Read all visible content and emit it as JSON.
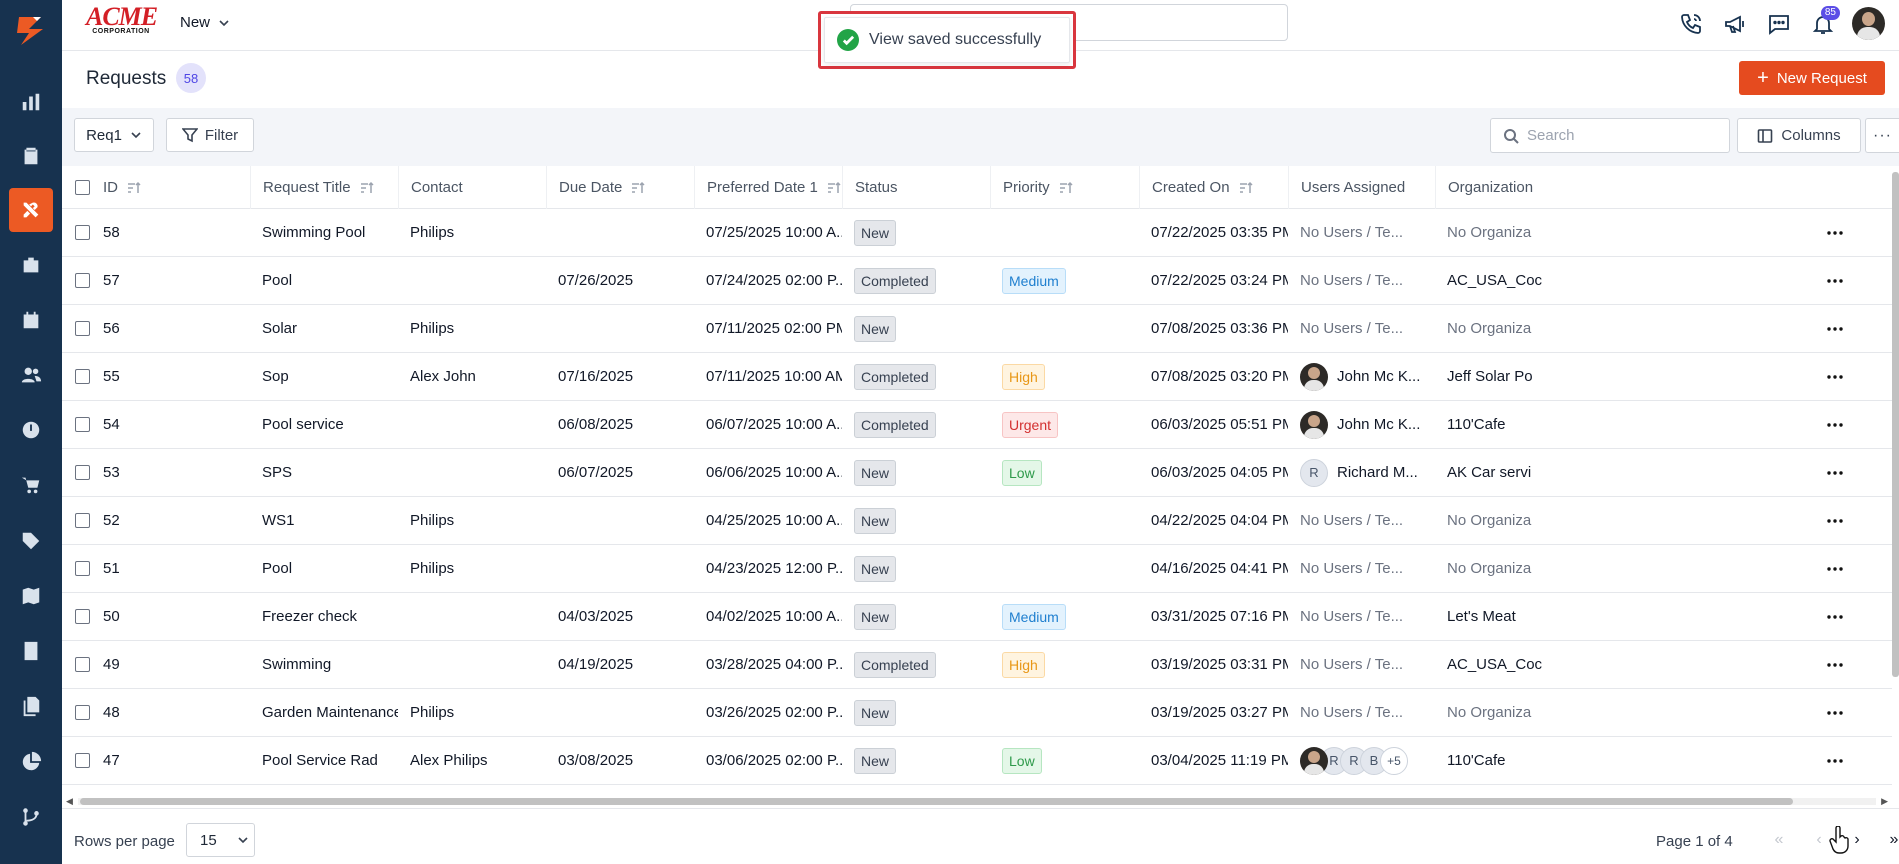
{
  "app": {
    "logo_text": "ACME",
    "logo_sub": "CORPORATION",
    "new_menu_label": "New",
    "notification_count": "85"
  },
  "toast": {
    "message": "View saved successfully"
  },
  "page": {
    "title": "Requests",
    "count": "58",
    "new_button": "New Request"
  },
  "toolbar": {
    "view_name": "Req1",
    "filter_label": "Filter",
    "search_placeholder": "Search",
    "columns_label": "Columns",
    "more_label": "···"
  },
  "table": {
    "columns": [
      "ID",
      "Request Title",
      "Contact",
      "Due Date",
      "Preferred Date 1",
      "Status",
      "Priority",
      "Created On",
      "Users Assigned",
      "Organization"
    ],
    "rows": [
      {
        "id": "58",
        "title": "Swimming Pool",
        "contact": "Philips",
        "due": "",
        "preferred": "07/25/2025 10:00 A...",
        "status": "New",
        "priority": "",
        "created": "07/22/2025 03:35 PM",
        "users": {
          "type": "none",
          "text": "No Users / Te..."
        },
        "org": "No Organiza",
        "org_muted": true
      },
      {
        "id": "57",
        "title": "Pool",
        "contact": "",
        "due": "07/26/2025",
        "preferred": "07/24/2025 02:00 P...",
        "status": "Completed",
        "priority": "Medium",
        "created": "07/22/2025 03:24 PM",
        "users": {
          "type": "none",
          "text": "No Users / Te..."
        },
        "org": "AC_USA_Coc",
        "org_muted": false
      },
      {
        "id": "56",
        "title": "Solar",
        "contact": "Philips",
        "due": "",
        "preferred": "07/11/2025 02:00 PM...",
        "status": "New",
        "priority": "",
        "created": "07/08/2025 03:36 PM",
        "users": {
          "type": "none",
          "text": "No Users / Te..."
        },
        "org": "No Organiza",
        "org_muted": true
      },
      {
        "id": "55",
        "title": "Sop",
        "contact": "Alex John",
        "due": "07/16/2025",
        "preferred": "07/11/2025 10:00 AM...",
        "status": "Completed",
        "priority": "High",
        "created": "07/08/2025 03:20 PM",
        "users": {
          "type": "photo",
          "text": "John Mc K..."
        },
        "org": "Jeff Solar Po",
        "org_muted": false
      },
      {
        "id": "54",
        "title": "Pool service",
        "contact": "",
        "due": "06/08/2025",
        "preferred": "06/07/2025 10:00 A...",
        "status": "Completed",
        "priority": "Urgent",
        "created": "06/03/2025 05:51 PM",
        "users": {
          "type": "photo",
          "text": "John Mc K..."
        },
        "org": "110'Cafe",
        "org_muted": false
      },
      {
        "id": "53",
        "title": "SPS",
        "contact": "",
        "due": "06/07/2025",
        "preferred": "06/06/2025 10:00 A...",
        "status": "New",
        "priority": "Low",
        "created": "06/03/2025 04:05 PM",
        "users": {
          "type": "initial",
          "initial": "R",
          "text": "Richard M..."
        },
        "org": "AK Car servi",
        "org_muted": false
      },
      {
        "id": "52",
        "title": "WS1",
        "contact": "Philips",
        "due": "",
        "preferred": "04/25/2025 10:00 A...",
        "status": "New",
        "priority": "",
        "created": "04/22/2025 04:04 PM",
        "users": {
          "type": "none",
          "text": "No Users / Te..."
        },
        "org": "No Organiza",
        "org_muted": true
      },
      {
        "id": "51",
        "title": "Pool",
        "contact": "Philips",
        "due": "",
        "preferred": "04/23/2025 12:00 P...",
        "status": "New",
        "priority": "",
        "created": "04/16/2025 04:41 PM",
        "users": {
          "type": "none",
          "text": "No Users / Te..."
        },
        "org": "No Organiza",
        "org_muted": true
      },
      {
        "id": "50",
        "title": "Freezer check",
        "contact": "",
        "due": "04/03/2025",
        "preferred": "04/02/2025 10:00 A...",
        "status": "New",
        "priority": "Medium",
        "created": "03/31/2025 07:16 PM",
        "users": {
          "type": "none",
          "text": "No Users / Te..."
        },
        "org": "Let's Meat",
        "org_muted": false
      },
      {
        "id": "49",
        "title": "Swimming",
        "contact": "",
        "due": "04/19/2025",
        "preferred": "03/28/2025 04:00 P...",
        "status": "Completed",
        "priority": "High",
        "created": "03/19/2025 03:31 PM",
        "users": {
          "type": "none",
          "text": "No Users / Te..."
        },
        "org": "AC_USA_Coc",
        "org_muted": false
      },
      {
        "id": "48",
        "title": "Garden Maintenance",
        "contact": "Philips",
        "due": "",
        "preferred": "03/26/2025 02:00 P...",
        "status": "New",
        "priority": "",
        "created": "03/19/2025 03:27 PM",
        "users": {
          "type": "none",
          "text": "No Users / Te..."
        },
        "org": "No Organiza",
        "org_muted": true
      },
      {
        "id": "47",
        "title": "Pool Service Rad",
        "contact": "Alex Philips",
        "due": "03/08/2025",
        "preferred": "03/06/2025 02:00 P...",
        "status": "New",
        "priority": "Low",
        "created": "03/04/2025 11:19 PM",
        "users": {
          "type": "stack",
          "initials": [
            "R",
            "R",
            "B"
          ],
          "more": "+5"
        },
        "org": "110'Cafe",
        "org_muted": false
      }
    ]
  },
  "footer": {
    "rows_per_page_label": "Rows per page",
    "rows_per_page_value": "15",
    "page_info": "Page 1 of 4"
  }
}
